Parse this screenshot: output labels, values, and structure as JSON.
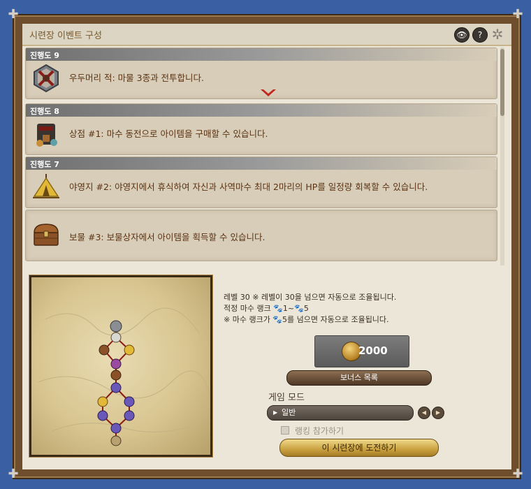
{
  "window": {
    "title": "시련장 이벤트 구성",
    "eye_label": "👁",
    "help_label": "?",
    "tools_label": "✲"
  },
  "cards": [
    {
      "stage": "진행도 9",
      "text": "우두머리 적: 마물 3종과 전투합니다.",
      "icon": "boss-battle-icon",
      "expanded": true
    },
    {
      "stage": "진행도 8",
      "text": "상점 #1: 마수 동전으로 아이템을 구매할 수 있습니다.",
      "icon": "shop-icon"
    },
    {
      "stage": "진행도 7",
      "text": "야영지 #2: 야영지에서 휴식하여 자신과 사역마수 최대 2마리의 HP를 일정량 회복할 수 있습니다.",
      "icon": "campsite-tent-icon"
    },
    {
      "stage": "",
      "text": "보물 #3: 보물상자에서 아이템을 획득할 수 있습니다.",
      "icon": "treasure-chest-icon"
    }
  ],
  "info": {
    "line1": "레벨 30 ※ 레벨이 30을 넘으면 자동으로 조율됩니다.",
    "line2": "적정 마수 랭크 🐾1~🐾5",
    "line3": "※ 마수 랭크가 🐾5를 넘으면 자동으로 조율됩니다."
  },
  "reward": {
    "value": "2000",
    "icon": "coin-icon"
  },
  "bonus_button": "보너스 목록",
  "mode": {
    "label": "게임 모드",
    "selected": "일반",
    "prev_icon": "◀",
    "next_icon": "▶",
    "select_marker": "▶"
  },
  "ranking": {
    "label": "랭킹 참가하기",
    "checked": false
  },
  "challenge_button": "이 시련장에 도전하기",
  "colors": {
    "accent_gold": "#c9a140",
    "frame_brown": "#6e4e2c",
    "background_blue": "#3a5fa3"
  }
}
